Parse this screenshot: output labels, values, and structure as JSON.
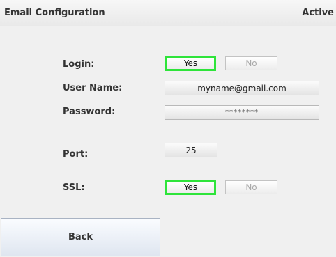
{
  "header": {
    "title": "Email Configuration",
    "status": "Active"
  },
  "login": {
    "label": "Login:",
    "yes": "Yes",
    "no": "No",
    "selected": "yes"
  },
  "user_name": {
    "label": "User Name:",
    "value": "myname@gmail.com"
  },
  "password": {
    "label": "Password:",
    "value": "********"
  },
  "port": {
    "label": "Port:",
    "value": "25"
  },
  "ssl": {
    "label": "SSL:",
    "yes": "Yes",
    "no": "No",
    "selected": "yes"
  },
  "footer": {
    "back_label": "Back"
  },
  "colors": {
    "selected_border": "#2ee43a",
    "background": "#f0f0f0"
  }
}
